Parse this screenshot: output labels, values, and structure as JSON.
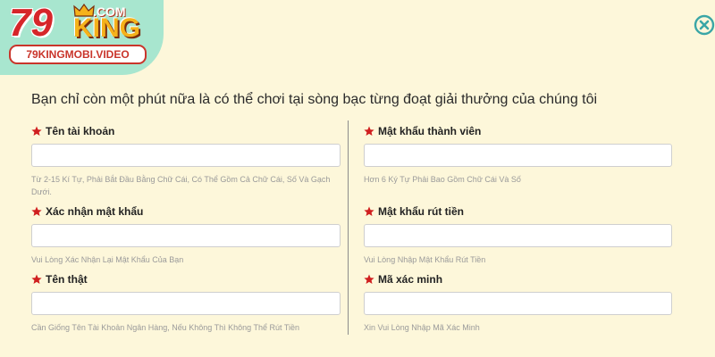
{
  "logo": {
    "big_number": "79",
    "com": ".COM",
    "brand": "KING",
    "domain": "79KINGMOBI.VIDEO"
  },
  "title": "Bạn chỉ còn một phút nữa là có thể chơi tại sòng bạc từng đoạt giải thưởng của chúng tôi",
  "icons": {
    "close": "close-circle-icon",
    "required": "star-icon",
    "crown": "crown-icon"
  },
  "colors": {
    "background": "#fdf7da",
    "logo_bg": "#a8e6cf",
    "required_star": "#d01f1f",
    "close_icon": "#3aa6a6",
    "hint_text": "#9a9a9a"
  },
  "left_fields": [
    {
      "label": "Tên tài khoản",
      "value": "",
      "hint": "Từ 2-15 Kí Tự, Phải Bắt Đầu Bằng Chữ Cái, Có Thể Gồm Cả Chữ Cái, Số Và Gạch Dưới."
    },
    {
      "label": "Xác nhận mật khẩu",
      "value": "",
      "hint": "Vui Lòng Xác Nhận Lại Mật Khẩu Của Bạn"
    },
    {
      "label": "Tên thật",
      "value": "",
      "hint": "Cần Giống Tên Tài Khoản Ngân Hàng, Nếu Không Thì Không Thể Rút Tiền"
    }
  ],
  "right_fields": [
    {
      "label": "Mật khẩu thành viên",
      "value": "",
      "hint": "Hơn 6 Ký Tự Phải Bao Gồm Chữ Cái Và Số"
    },
    {
      "label": "Mật khẩu rút tiền",
      "value": "",
      "hint": "Vui Lòng Nhập Mật Khẩu Rút Tiền"
    },
    {
      "label": "Mã xác minh",
      "value": "",
      "hint": "Xin Vui Lòng Nhập Mã Xác Minh"
    }
  ]
}
